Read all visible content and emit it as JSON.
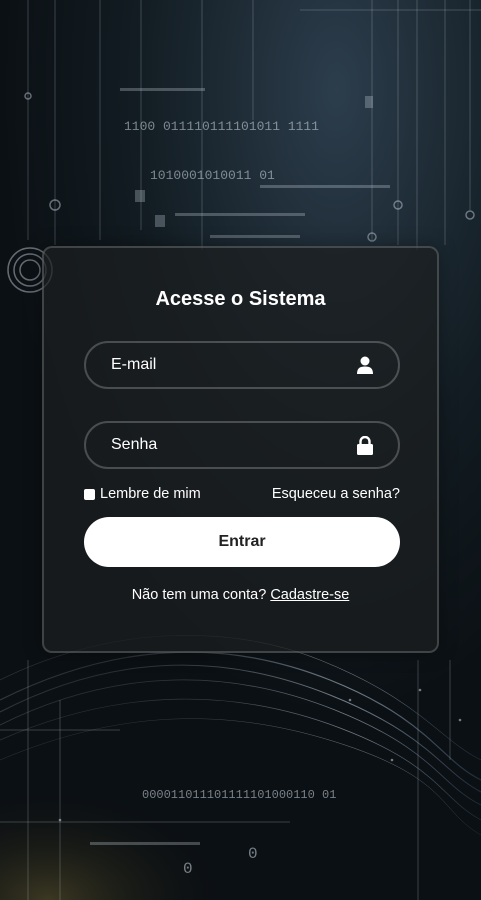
{
  "background": {
    "binary_rows": [
      "1100 011110111101011 1111",
      "1010001010011 01",
      "000011011101111101000110 01",
      "0",
      "0"
    ]
  },
  "login_card": {
    "title": "Acesse o Sistema",
    "email_placeholder": "E-mail",
    "email_icon": "user-icon",
    "password_placeholder": "Senha",
    "password_icon": "lock-icon",
    "remember_label": "Lembre de mim",
    "forgot_label": "Esqueceu a senha?",
    "submit_label": "Entrar",
    "register_prompt": "Não tem uma conta?",
    "register_link": "Cadastre-se"
  }
}
